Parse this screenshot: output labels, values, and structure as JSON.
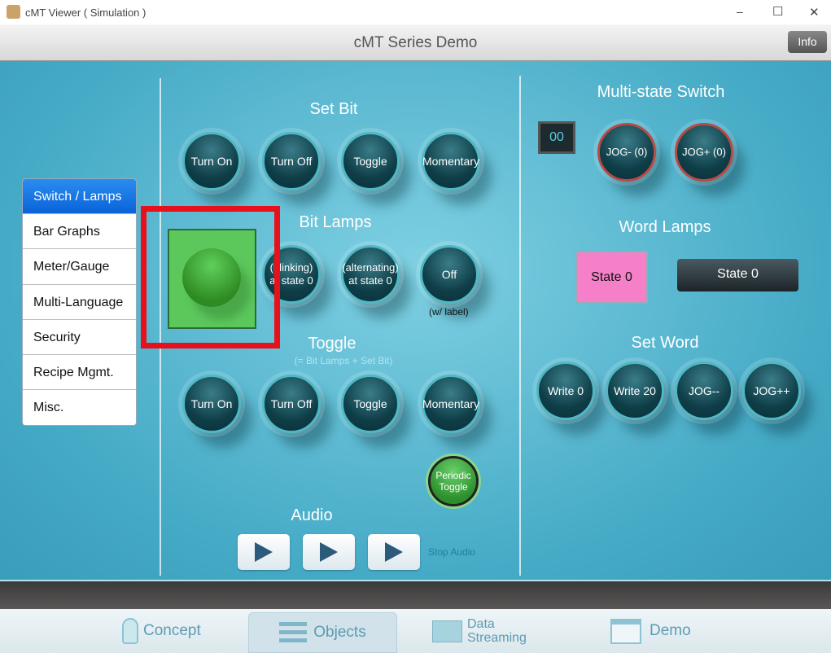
{
  "window": {
    "title": "cMT Viewer ( Simulation )",
    "minimize": "–",
    "maximize": "☐",
    "close": "✕"
  },
  "header": {
    "title": "cMT Series Demo",
    "info_label": "Info"
  },
  "sidebar": {
    "items": [
      {
        "label": "Switch / Lamps",
        "selected": true
      },
      {
        "label": "Bar Graphs"
      },
      {
        "label": "Meter/Gauge"
      },
      {
        "label": "Multi-Language"
      },
      {
        "label": "Security"
      },
      {
        "label": "Recipe Mgmt."
      },
      {
        "label": "Misc."
      }
    ]
  },
  "set_bit": {
    "title": "Set Bit",
    "buttons": [
      "Turn On",
      "Turn Off",
      "Toggle",
      "Momentary"
    ]
  },
  "bit_lamps": {
    "title": "Bit Lamps",
    "lamps": [
      "(blinking) at state 0",
      "(alternating) at state 0",
      "Off"
    ],
    "caption": "(w/ label)"
  },
  "toggle": {
    "title": "Toggle",
    "subtitle": "(= Bit Lamps + Set Bit)",
    "buttons": [
      "Turn On",
      "Turn Off",
      "Toggle",
      "Momentary"
    ],
    "periodic": "Periodic Toggle"
  },
  "audio": {
    "title": "Audio",
    "stop": "Stop Audio"
  },
  "multi_state": {
    "title": "Multi-state Switch",
    "display": "00",
    "buttons": [
      "JOG- (0)",
      "JOG+ (0)"
    ]
  },
  "word_lamps": {
    "title": "Word Lamps",
    "lamp1": "State 0",
    "lamp2": "State 0",
    "lamp1_color": "#f57fc8"
  },
  "set_word": {
    "title": "Set Word",
    "buttons": [
      "Write 0",
      "Write 20",
      "JOG--",
      "JOG++"
    ]
  },
  "nav": {
    "items": [
      {
        "label": "Concept",
        "icon": "lightbulb-icon"
      },
      {
        "label": "Objects",
        "icon": "sliders-icon",
        "active": true
      },
      {
        "label": "Data Streaming",
        "icon": "chart-icon"
      },
      {
        "label": "Demo",
        "icon": "window-icon"
      }
    ]
  },
  "colors": {
    "highlight": "#e8101a",
    "lamp_on": "#5cc85c"
  }
}
